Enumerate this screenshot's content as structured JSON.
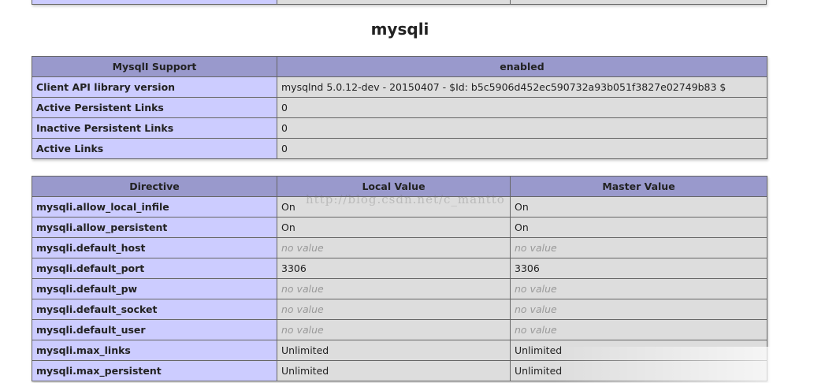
{
  "section": {
    "title": "mysqli"
  },
  "support_table": {
    "header": [
      "MysqlI Support",
      "enabled"
    ],
    "rows": [
      {
        "name": "Client API library version",
        "value": "mysqlnd 5.0.12-dev - 20150407 - $Id: b5c5906d452ec590732a93b051f3827e02749b83 $"
      },
      {
        "name": "Active Persistent Links",
        "value": "0"
      },
      {
        "name": "Inactive Persistent Links",
        "value": "0"
      },
      {
        "name": "Active Links",
        "value": "0"
      }
    ]
  },
  "directive_table": {
    "header": [
      "Directive",
      "Local Value",
      "Master Value"
    ],
    "rows": [
      {
        "name": "mysqli.allow_local_infile",
        "local": "On",
        "master": "On"
      },
      {
        "name": "mysqli.allow_persistent",
        "local": "On",
        "master": "On"
      },
      {
        "name": "mysqli.default_host",
        "local": "no value",
        "master": "no value"
      },
      {
        "name": "mysqli.default_port",
        "local": "3306",
        "master": "3306"
      },
      {
        "name": "mysqli.default_pw",
        "local": "no value",
        "master": "no value"
      },
      {
        "name": "mysqli.default_socket",
        "local": "no value",
        "master": "no value"
      },
      {
        "name": "mysqli.default_user",
        "local": "no value",
        "master": "no value"
      },
      {
        "name": "mysqli.max_links",
        "local": "Unlimited",
        "master": "Unlimited"
      },
      {
        "name": "mysqli.max_persistent",
        "local": "Unlimited",
        "master": "Unlimited"
      }
    ]
  },
  "watermark": {
    "text": "http://blog.csdn.net/c_mantto"
  },
  "colors": {
    "header_bg": "#9999cc",
    "name_cell_bg": "#ccccff",
    "value_cell_bg": "#dddddd",
    "no_value_text": "#999999"
  }
}
